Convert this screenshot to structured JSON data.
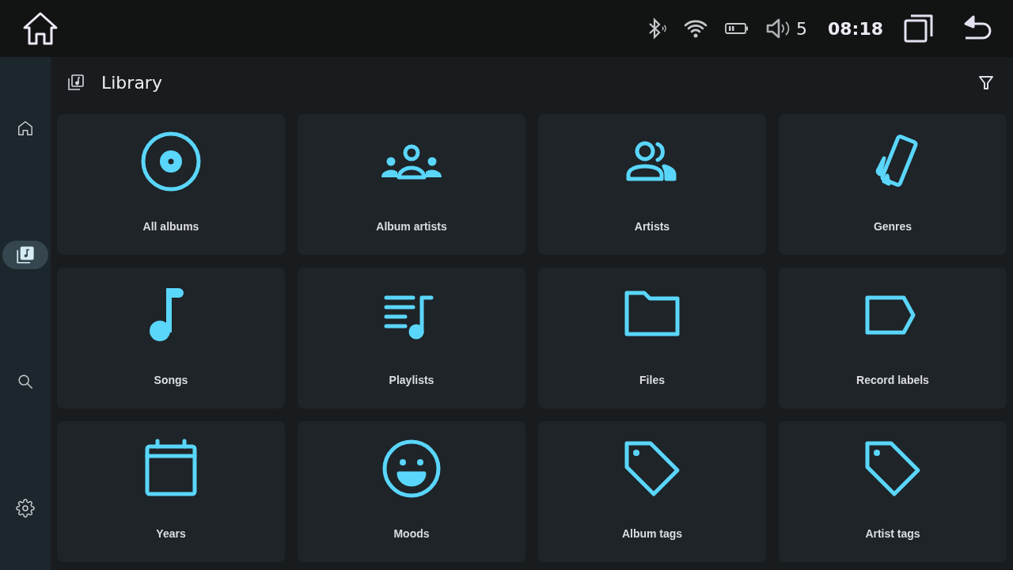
{
  "status_bar": {
    "volume": "5",
    "time": "08:18"
  },
  "sidebar": {
    "items": [
      {
        "kind": "home",
        "selected": false
      },
      {
        "kind": "library",
        "selected": true
      },
      {
        "kind": "search",
        "selected": false
      },
      {
        "kind": "settings",
        "selected": false
      }
    ]
  },
  "header": {
    "title": "Library"
  },
  "tiles": [
    {
      "kind": "disc",
      "label": "All albums"
    },
    {
      "kind": "group",
      "label": "Album artists"
    },
    {
      "kind": "people",
      "label": "Artists"
    },
    {
      "kind": "cards",
      "label": "Genres"
    },
    {
      "kind": "note",
      "label": "Songs"
    },
    {
      "kind": "playlist",
      "label": "Playlists"
    },
    {
      "kind": "folder",
      "label": "Files"
    },
    {
      "kind": "label",
      "label": "Record labels"
    },
    {
      "kind": "calendar",
      "label": "Years"
    },
    {
      "kind": "smile",
      "label": "Moods"
    },
    {
      "kind": "tag",
      "label": "Album tags"
    },
    {
      "kind": "tag",
      "label": "Artist tags"
    }
  ]
}
